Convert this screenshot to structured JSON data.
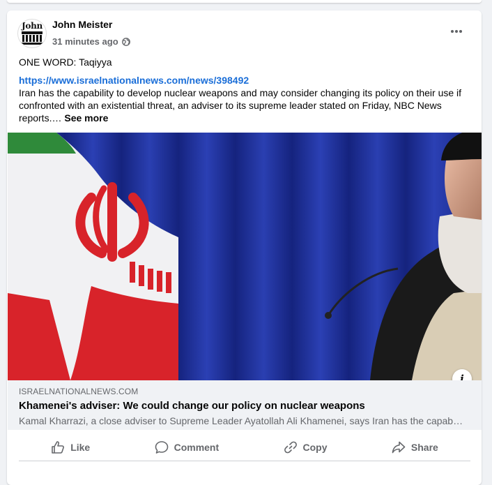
{
  "post": {
    "author": "John Meister",
    "avatar_text": "John",
    "timestamp": "31 minutes ago",
    "privacy_icon": "globe-icon",
    "menu_icon": "more-options-icon",
    "caption": "ONE WORD:  Taqiyya",
    "link_url": "https://www.israelnationalnews.com/news/398492",
    "body_text": "Iran has the capability to develop nuclear weapons and may consider changing its policy on their use if confronted with an existential threat, an adviser to its supreme leader stated on Friday, NBC News reports.… ",
    "see_more": "See more"
  },
  "link_preview": {
    "domain": "ISRAELNATIONALNEWS.COM",
    "title": "Khamenei's adviser: We could change our policy on nuclear weapons",
    "description": "Kamal Kharrazi, a close adviser to Supreme Leader Ayatollah Ali Khamenei, says Iran has the capability to develop nuclear weapons and may consider changing its policy.",
    "info_glyph": "i"
  },
  "actions": [
    {
      "label": "Like",
      "icon": "thumbs-up-icon"
    },
    {
      "label": "Comment",
      "icon": "comment-icon"
    },
    {
      "label": "Copy",
      "icon": "link-icon"
    },
    {
      "label": "Share",
      "icon": "share-icon"
    }
  ],
  "colors": {
    "link": "#1a6ed8",
    "secondary_text": "#65676b",
    "curtain": "#1b2c8c"
  }
}
